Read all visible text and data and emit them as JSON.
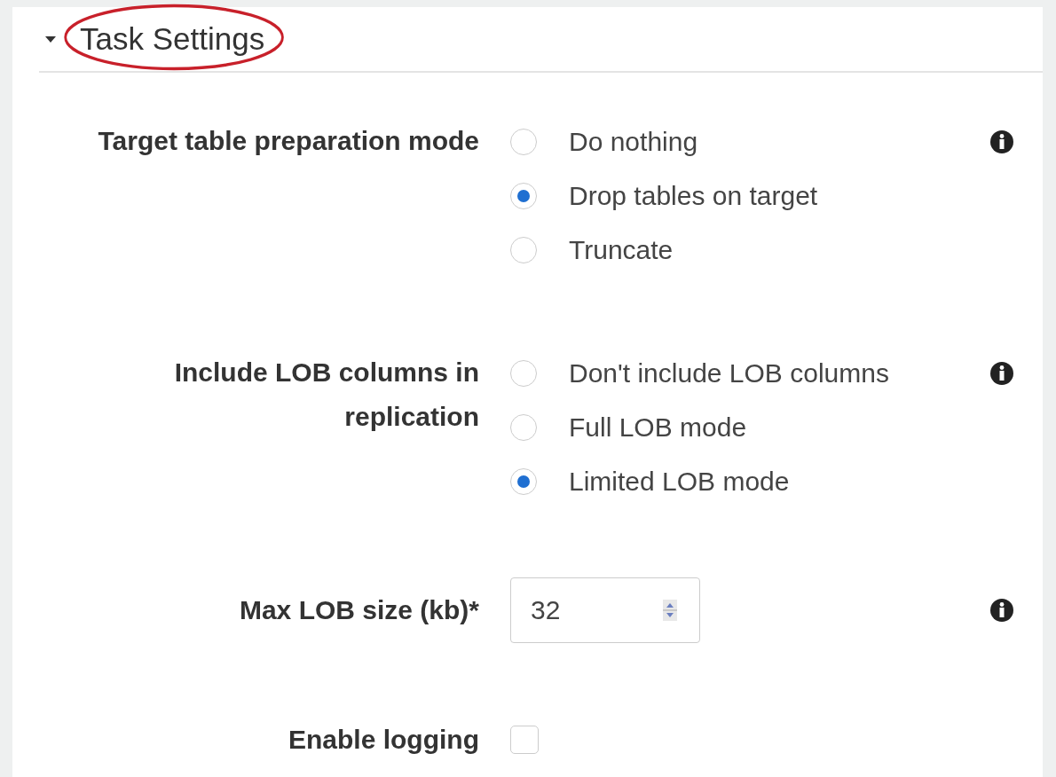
{
  "section": {
    "title": "Task Settings",
    "expanded": true,
    "highlighted": true
  },
  "fields": [
    {
      "kind": "radio",
      "label": "Target table preparation mode",
      "info": true,
      "options": [
        {
          "label": "Do nothing",
          "selected": false
        },
        {
          "label": "Drop tables on target",
          "selected": true
        },
        {
          "label": "Truncate",
          "selected": false
        }
      ]
    },
    {
      "kind": "radio",
      "label": "Include LOB columns in replication",
      "info": true,
      "options": [
        {
          "label": "Don't include LOB columns",
          "selected": false
        },
        {
          "label": "Full LOB mode",
          "selected": false
        },
        {
          "label": "Limited LOB mode",
          "selected": true
        }
      ]
    },
    {
      "kind": "number",
      "label": "Max LOB size (kb)*",
      "value": "32",
      "info": true
    },
    {
      "kind": "checkbox",
      "label": "Enable logging",
      "checked": false
    }
  ]
}
